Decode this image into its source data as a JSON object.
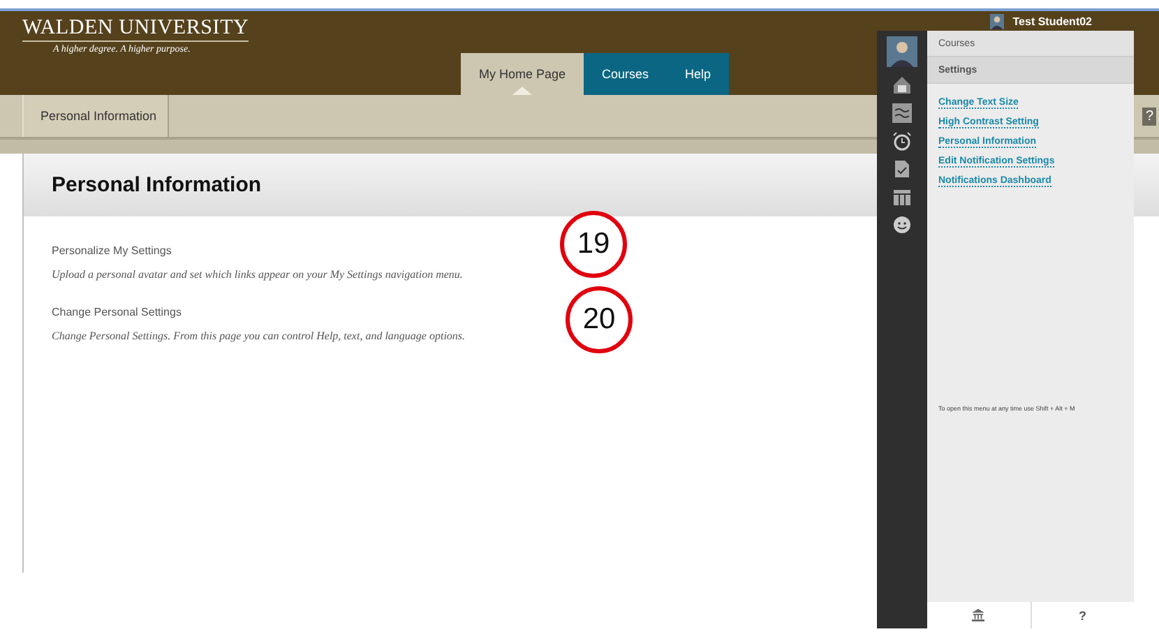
{
  "brand": {
    "name": "WALDEN UNIVERSITY",
    "tagline": "A higher degree. A higher purpose."
  },
  "user": {
    "name": "Test Student02"
  },
  "tabs": [
    {
      "label": "My Home Page",
      "selected": true
    },
    {
      "label": "Courses",
      "selected": false
    },
    {
      "label": "Help",
      "selected": false
    }
  ],
  "breadcrumb": "Personal Information",
  "help_button": "?",
  "page_title": "Personal Information",
  "sections": [
    {
      "title": "Personalize My Settings",
      "description": "Upload a personal avatar and set which links appear on your My Settings navigation menu.",
      "callout": "19"
    },
    {
      "title": "Change Personal Settings",
      "description": "Change Personal Settings. From this page you can control Help, text, and language options.",
      "callout": "20"
    }
  ],
  "menu": {
    "headers": [
      {
        "label": "Courses",
        "selected": false
      },
      {
        "label": "Settings",
        "selected": true
      }
    ],
    "links": [
      "Change Text Size",
      "High Contrast Setting",
      "Personal Information",
      "Edit Notification Settings",
      "Notifications Dashboard"
    ],
    "hint": "To open this menu at any time use Shift + Alt + M",
    "footer_help": "?"
  }
}
